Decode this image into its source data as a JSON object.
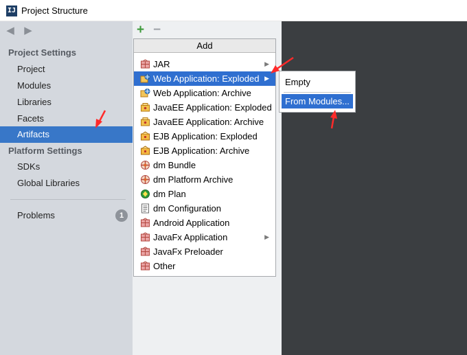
{
  "window": {
    "title": "Project Structure",
    "icon": "intellij-icon",
    "icon_text": "IJ"
  },
  "sidebar": {
    "nav": {
      "back_icon": "arrow-left-icon",
      "forward_icon": "arrow-right-icon"
    },
    "project_settings_label": "Project Settings",
    "project_items": [
      "Project",
      "Modules",
      "Libraries",
      "Facets",
      "Artifacts"
    ],
    "selected_item": "Artifacts",
    "platform_settings_label": "Platform Settings",
    "platform_items": [
      "SDKs",
      "Global Libraries"
    ],
    "problems_label": "Problems",
    "problems_count": "1"
  },
  "toolbar": {
    "add_icon": "plus-icon",
    "add_text": "+",
    "remove_icon": "minus-icon",
    "remove_text": "−"
  },
  "add_menu": {
    "header": "Add",
    "items": [
      {
        "label": "JAR",
        "icon": "jar-icon",
        "submenu": true
      },
      {
        "label": "Web Application: Exploded",
        "icon": "web-app-icon",
        "submenu": true,
        "highlighted": true
      },
      {
        "label": "Web Application: Archive",
        "icon": "web-app-icon",
        "submenu": false
      },
      {
        "label": "JavaEE Application: Exploded",
        "icon": "javaee-icon",
        "submenu": false
      },
      {
        "label": "JavaEE Application: Archive",
        "icon": "javaee-icon",
        "submenu": false
      },
      {
        "label": "EJB Application: Exploded",
        "icon": "ejb-icon",
        "submenu": false
      },
      {
        "label": "EJB Application: Archive",
        "icon": "ejb-icon",
        "submenu": false
      },
      {
        "label": "dm Bundle",
        "icon": "dm-bundle-icon",
        "submenu": false
      },
      {
        "label": "dm Platform Archive",
        "icon": "dm-bundle-icon",
        "submenu": false
      },
      {
        "label": "dm Plan",
        "icon": "dm-plan-icon",
        "submenu": false
      },
      {
        "label": "dm Configuration",
        "icon": "dm-config-icon",
        "submenu": false
      },
      {
        "label": "Android Application",
        "icon": "jar-icon",
        "submenu": false
      },
      {
        "label": "JavaFx Application",
        "icon": "jar-icon",
        "submenu": true
      },
      {
        "label": "JavaFx Preloader",
        "icon": "jar-icon",
        "submenu": false
      },
      {
        "label": "Other",
        "icon": "jar-icon",
        "submenu": false
      }
    ]
  },
  "submenu": {
    "items": [
      {
        "label": "Empty",
        "highlighted": false
      },
      {
        "label": "From Modules...",
        "highlighted": true
      }
    ]
  },
  "colors": {
    "selection": "#3877c8",
    "menu_highlight": "#2f6fd0",
    "annotation_arrow": "#ff2a2a",
    "editor_bg": "#3b3e41",
    "sidebar_bg": "#d4d8de"
  }
}
